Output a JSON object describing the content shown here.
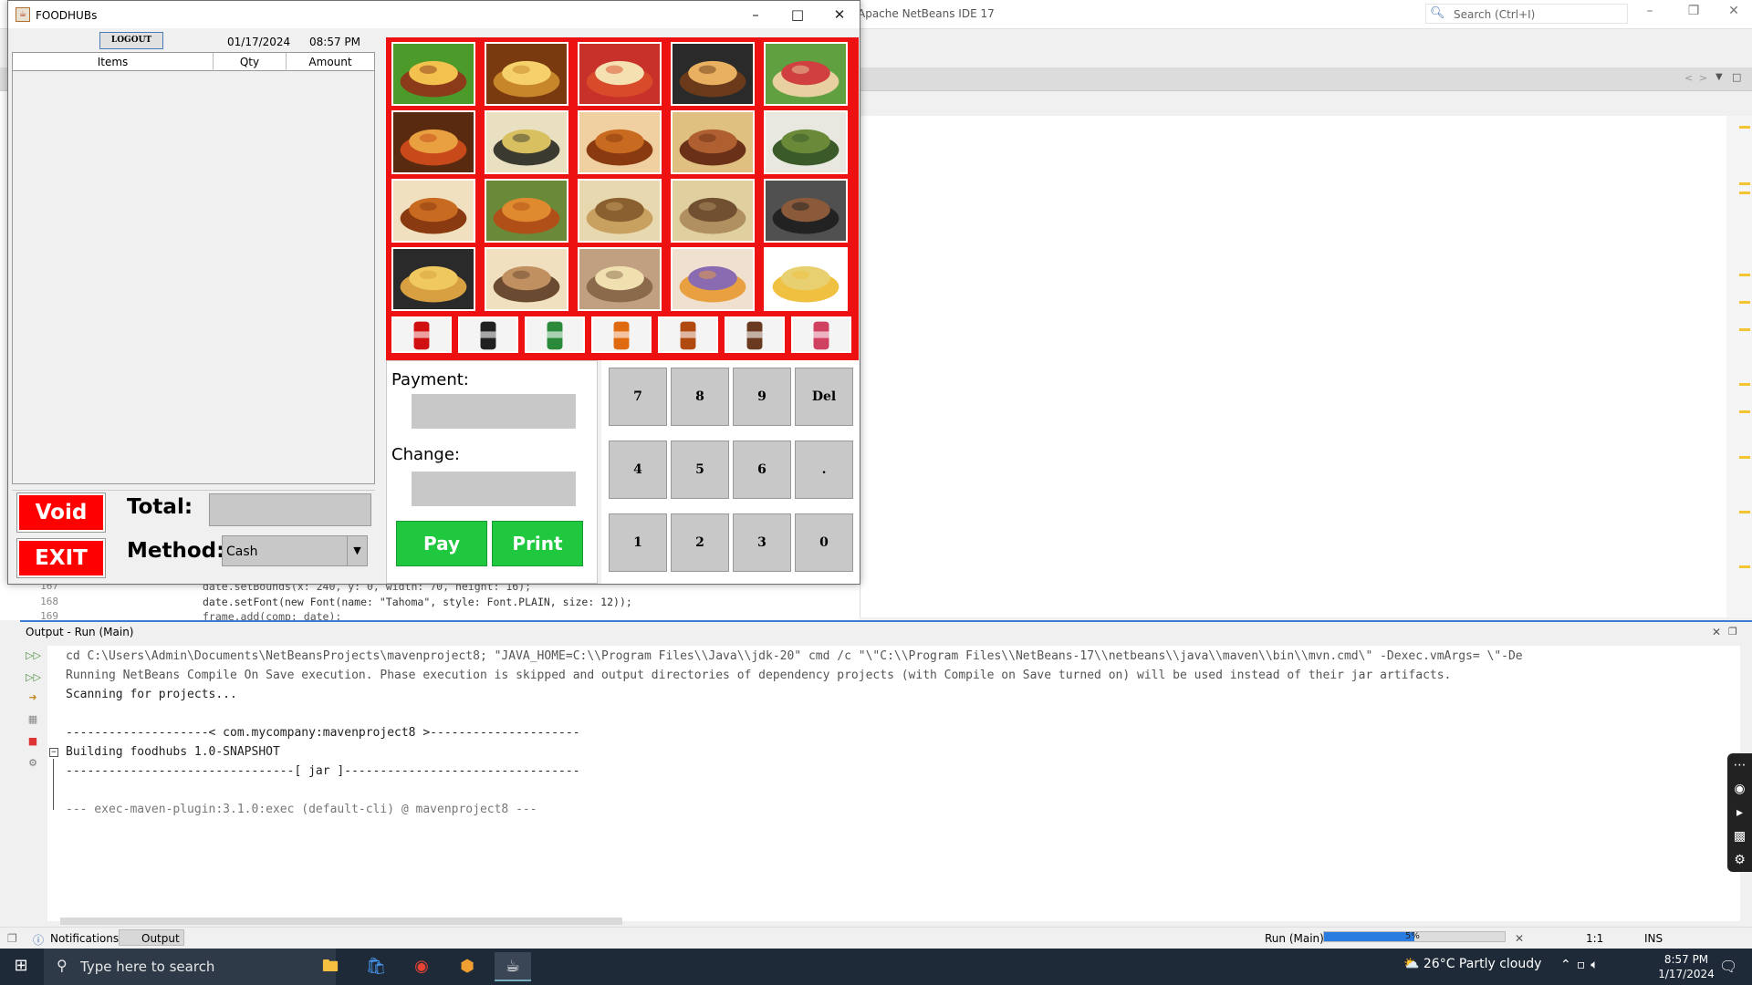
{
  "netbeans": {
    "title": "Apache NetBeans IDE 17",
    "search_placeholder": "Search (Ctrl+I)",
    "code_lines": [
      {
        "num": "167",
        "text": "date.setBounds(x: 240, y: 0, width: 70, height: 16);"
      },
      {
        "num": "168",
        "text": "date.setFont(new Font(name: \"Tahoma\", style: Font.PLAIN, size: 12));"
      },
      {
        "num": "169",
        "text": "frame.add(comp: date);"
      }
    ],
    "output_title": "Output - Run (Main)",
    "output_lines": [
      "cd C:\\Users\\Admin\\Documents\\NetBeansProjects\\mavenproject8; \"JAVA_HOME=C:\\\\Program Files\\\\Java\\\\jdk-20\" cmd /c \"\\\"C:\\\\Program Files\\\\NetBeans-17\\\\netbeans\\\\java\\\\maven\\\\bin\\\\mvn.cmd\\\" -Dexec.vmArgs= \\\"-De",
      "Running NetBeans Compile On Save execution. Phase execution is skipped and output directories of dependency projects (with Compile on Save turned on) will be used instead of their jar artifacts.",
      "Scanning for projects...",
      "",
      "--------------------< com.mycompany:mavenproject8 >---------------------",
      "Building foodhubs 1.0-SNAPSHOT",
      "--------------------------------[ jar ]---------------------------------",
      "",
      "--- exec-maven-plugin:3.1.0:exec (default-cli) @ mavenproject8 ---"
    ],
    "status": {
      "notifications": "Notifications",
      "output": "Output",
      "run": "Run (Main)",
      "progress_label": "5%",
      "progress": 0.5,
      "position": "1:1",
      "mode": "INS"
    }
  },
  "app": {
    "title": "FOODHUBs",
    "logout_label": "LOGOUT",
    "date": "01/17/2024",
    "time": "08:57 PM",
    "columns": [
      "Items",
      "Qty",
      "Amount"
    ],
    "void_label": "Void",
    "exit_label": "EXIT",
    "total_label": "Total:",
    "method_label": "Method:",
    "method_value": "Cash",
    "payment_label": "Payment:",
    "change_label": "Change:",
    "pay_label": "Pay",
    "print_label": "Print",
    "keys": [
      "7",
      "8",
      "9",
      "Del",
      "4",
      "5",
      "6",
      ".",
      "1",
      "2",
      "3",
      "0"
    ],
    "colors": {
      "grid_border": "#ee1111",
      "void": "#ff0000",
      "pay": "#20c840"
    },
    "food_items": [
      "burger-image",
      "cheeseburger-image",
      "hotdog-image",
      "burger-image-2",
      "sandwich-image",
      "spaghetti-image",
      "paella-image",
      "fried-chicken-image",
      "grilled-meat-image",
      "broccoli-image",
      "chicken-wings-image",
      "roast-chicken-image",
      "fried-rice-image",
      "fried-rice-image-2",
      "sausage-pan-image",
      "fish-sticks-image",
      "sizzling-onion-image",
      "steak-plate-image",
      "milkshake-image",
      "french-fries-image"
    ],
    "drink_items": [
      "coca-cola-image",
      "coke-bottle-image",
      "sprite-image",
      "orange-soda-image",
      "iced-tea-image",
      "dessert-image",
      "smoothie-image"
    ]
  },
  "taskbar": {
    "search_placeholder": "Type here to search",
    "weather": "26°C  Partly cloudy",
    "time": "8:57 PM",
    "date": "1/17/2024"
  }
}
